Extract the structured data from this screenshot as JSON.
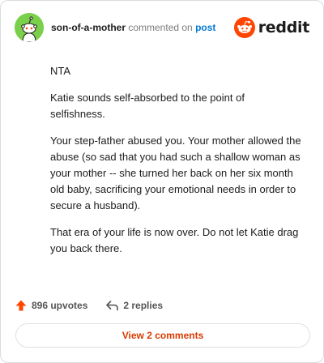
{
  "comment": {
    "author": "son-of-a-mother",
    "action_text": "commented on",
    "target_link": "post",
    "paragraphs": [
      "NTA",
      "Katie sounds self-absorbed to the point of selfishness.",
      "Your step-father abused you. Your mother allowed the abuse (so sad that you had such a shallow woman as your mother -- she turned her back on her six month old baby, sacrificing your emotional needs in order to secure a husband).",
      "That era of your life is now over. Do not let Katie drag you back there."
    ]
  },
  "brand": {
    "name": "reddit",
    "icon": "reddit-snoo-icon",
    "color": "#ff4500"
  },
  "stats": {
    "upvotes_label": "896 upvotes",
    "upvote_icon": "upvote-arrow-icon",
    "upvote_color": "#ff4500",
    "replies_label": "2 replies",
    "reply_icon": "reply-arrow-icon"
  },
  "footer": {
    "view_comments_label": "View 2 comments",
    "link_color": "#d93a00"
  },
  "avatar": {
    "icon": "snoo-avatar-icon",
    "background": "#7bd04b"
  }
}
